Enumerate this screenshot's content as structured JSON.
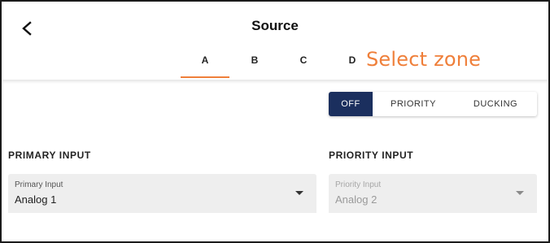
{
  "header": {
    "title": "Source",
    "back_icon": "chevron-left-icon"
  },
  "zones": {
    "tabs": [
      {
        "label": "A",
        "active": true
      },
      {
        "label": "B",
        "active": false
      },
      {
        "label": "C",
        "active": false
      },
      {
        "label": "D",
        "active": false
      }
    ],
    "note": "Select zone"
  },
  "priority_mode": {
    "options": [
      "OFF",
      "PRIORITY",
      "DUCKING"
    ],
    "selected": "OFF"
  },
  "primary": {
    "section_label": "PRIMARY INPUT",
    "field_label": "Primary Input",
    "value": "Analog 1",
    "enabled": true
  },
  "priority": {
    "section_label": "PRIORITY INPUT",
    "field_label": "Priority Input",
    "value": "Analog 2",
    "enabled": false
  },
  "colors": {
    "accent": "#ef7f3a",
    "selected_toggle": "#1b2f5e",
    "field_bg": "#eeeeee"
  }
}
